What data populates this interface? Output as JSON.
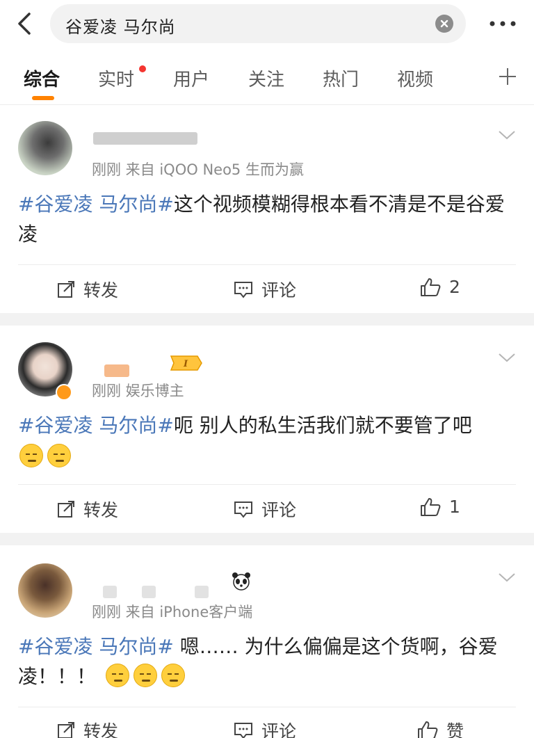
{
  "search": {
    "query": "谷爱凌 马尔尚"
  },
  "tabs": [
    {
      "label": "综合"
    },
    {
      "label": "实时"
    },
    {
      "label": "用户"
    },
    {
      "label": "关注"
    },
    {
      "label": "热门"
    },
    {
      "label": "视频"
    }
  ],
  "posts": [
    {
      "meta": "刚刚  来自 iQOO Neo5 生而为赢",
      "hashtag": "#谷爱凌 马尔尚#",
      "text": "这个视频模糊得根本看不清是不是谷爱凌",
      "repost_label": "转发",
      "comment_label": "评论",
      "like_count": "2"
    },
    {
      "meta": "刚刚  娱乐博主",
      "hashtag": "#谷爱凌 马尔尚#",
      "text": "呃 别人的私生活我们就不要管了吧",
      "repost_label": "转发",
      "comment_label": "评论",
      "like_count": "1"
    },
    {
      "meta": "刚刚  来自 iPhone客户端",
      "hashtag": "#谷爱凌 马尔尚#",
      "text": " 嗯…… 为什么偏偏是这个货啊，谷爱凌！！！",
      "repost_label": "转发",
      "comment_label": "评论",
      "like_count": "赞"
    }
  ],
  "colors": {
    "accent": "#ff8200",
    "hashtag": "#4a77b8",
    "unread_dot": "#f43530"
  }
}
